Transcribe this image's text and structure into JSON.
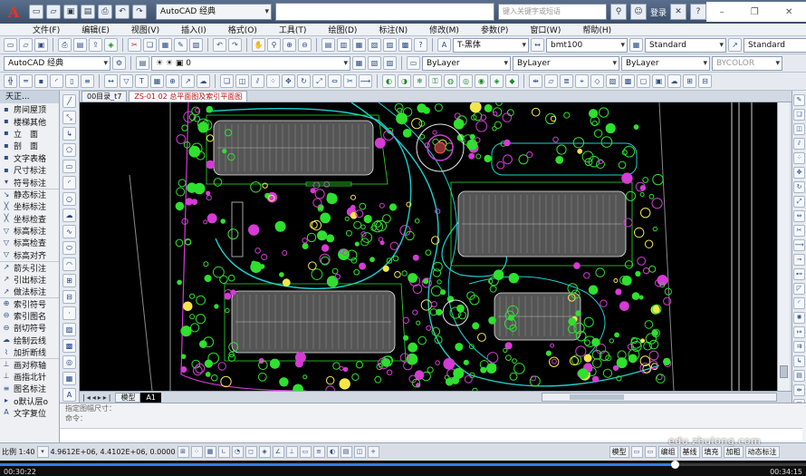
{
  "titlebar": {
    "logo": "A",
    "workspace": "AutoCAD 经典",
    "search_placeholder": "键入关键字或短语",
    "login": "登录",
    "help": "?"
  },
  "menu": [
    "文件(F)",
    "编辑(E)",
    "视图(V)",
    "插入(I)",
    "格式(O)",
    "工具(T)",
    "绘图(D)",
    "标注(N)",
    "修改(M)",
    "参数(P)",
    "窗口(W)",
    "帮助(H)"
  ],
  "toolbar1": {
    "text_style": "T-黑体",
    "dim_style": "bmt100",
    "table_style": "Standard",
    "mleader_style": "Standard"
  },
  "toolbar2": {
    "workspace": "AutoCAD 经典",
    "layer": "0",
    "color": "ByLayer",
    "linetype": "ByLayer",
    "lineweight": "ByLayer",
    "plotstyle": "BYCOLOR"
  },
  "left_palette": {
    "title": "天正...",
    "items": [
      {
        "icon": "▪",
        "label": "房间屋顶"
      },
      {
        "icon": "▪",
        "label": "楼梯其他"
      },
      {
        "icon": "▪",
        "label": "立　面"
      },
      {
        "icon": "▪",
        "label": "剖　面"
      },
      {
        "icon": "▪",
        "label": "文字表格"
      },
      {
        "icon": "▪",
        "label": "尺寸标注"
      },
      {
        "icon": "▾",
        "label": "符号标注"
      },
      {
        "icon": "↘",
        "label": "静态标注"
      },
      {
        "icon": "╳",
        "label": "坐标标注"
      },
      {
        "icon": "╳",
        "label": "坐标检查"
      },
      {
        "icon": "▽",
        "label": "标高标注"
      },
      {
        "icon": "▽",
        "label": "标高检查"
      },
      {
        "icon": "▽",
        "label": "标高对齐"
      },
      {
        "icon": "↗",
        "label": "箭头引注"
      },
      {
        "icon": "↗",
        "label": "引出标注"
      },
      {
        "icon": "↗",
        "label": "做法标注"
      },
      {
        "icon": "⊕",
        "label": "索引符号"
      },
      {
        "icon": "⊖",
        "label": "索引图名"
      },
      {
        "icon": "⊖",
        "label": "剖切符号"
      },
      {
        "icon": "☁",
        "label": "绘制云线"
      },
      {
        "icon": "⌇",
        "label": "加折断线"
      },
      {
        "icon": "⊥",
        "label": "画对称轴"
      },
      {
        "icon": "⊥",
        "label": "画指北针"
      },
      {
        "icon": "≡",
        "label": "图名标注"
      },
      {
        "icon": "▸",
        "label": "o默认层o"
      },
      {
        "icon": "A",
        "label": "文字复位"
      }
    ]
  },
  "doc_tabs": [
    {
      "label": "00目录_t7",
      "active": false
    },
    {
      "label": "ZS-01 02 总平面图及索引平面图",
      "active": true
    }
  ],
  "layout_tabs": [
    {
      "label": "模型",
      "active": false
    },
    {
      "label": "A1",
      "active": true
    }
  ],
  "command": {
    "line1": "指定图幅尺寸：",
    "line2": "命令："
  },
  "status": {
    "scale": "比例 1:40",
    "coords": "4.9612E+06, 4.4102E+06, 0.0000",
    "modes": [
      "模型",
      "编组",
      "基线",
      "填充",
      "加粗",
      "动态标注"
    ]
  },
  "watermark": "edu.zhulong.com",
  "player": {
    "time_current": "00:30:22",
    "time_total": "00:34:15",
    "progress": 0.837
  },
  "colors": {
    "canvas_bg": "#000000",
    "cad_green": "#2fe02f",
    "cad_magenta": "#d63bd6",
    "cad_cyan": "#1ed0d0",
    "cad_white": "#e8e8e8",
    "player_accent": "#2f7fe6"
  }
}
